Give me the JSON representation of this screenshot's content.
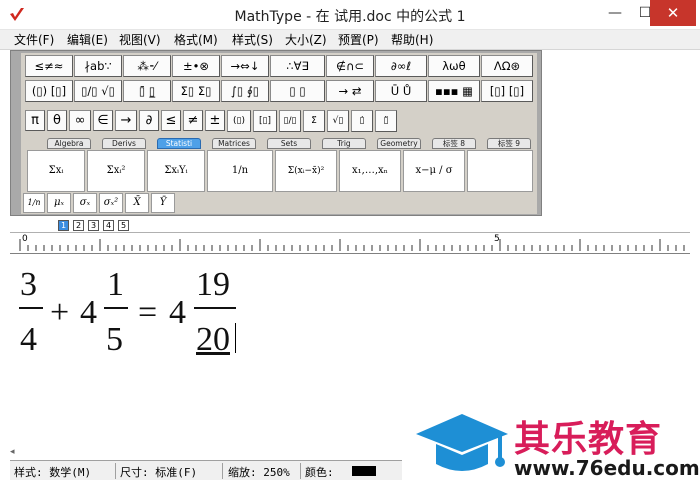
{
  "window": {
    "title": "MathType - 在 试用.doc 中的公式 1",
    "minimize": "—",
    "maximize": "☐",
    "close": "✕"
  },
  "menu": [
    "文件(F)",
    "编辑(E)",
    "视图(V)",
    "格式(M)",
    "样式(S)",
    "大小(Z)",
    "预置(P)",
    "帮助(H)"
  ],
  "palette_row1": [
    "≤≠≈",
    "∤ab∵",
    "⁂⁃⁄",
    "±•⊗",
    "→⇔↓",
    "∴∀∃",
    "∉∩⊂",
    "∂∞ℓ",
    "λωθ",
    "ΛΩ⊛"
  ],
  "palette_row2": [
    "(▯) [▯]",
    "▯/▯ √▯",
    "▯̄ ▯̲",
    "Σ▯ Σ▯",
    "∫▯ ∮▯",
    "▯ ▯",
    "→ ⇄",
    "Ū Ů",
    "▪▪▪ ▦",
    "[▯] [▯]"
  ],
  "symbol_bar": [
    "π",
    "θ",
    "∞",
    "∈",
    "→",
    "∂",
    "≤",
    "≠",
    "±",
    "(▯)",
    "[▯]",
    "▯/▯",
    "Σ̈",
    "√▯",
    "▯̇",
    "▯̈"
  ],
  "tabs": [
    "Algebra",
    "Derivs",
    "Statisti",
    "Matrices",
    "Sets",
    "Trig",
    "Geometry",
    "标签 8",
    "标签 9"
  ],
  "templates": [
    "Σxᵢ",
    "Σxᵢ²",
    "ΣxᵢYᵢ",
    "1/n",
    "Σ(xᵢ−x̄)²",
    "x₁,…,xₙ",
    "x−μ / σ"
  ],
  "templates_small": [
    "1/n",
    "μₓ",
    "σₓ",
    "σₓ²",
    "X̄",
    "Ȳ"
  ],
  "controls": [
    "1",
    "2",
    "3",
    "4",
    "5"
  ],
  "ruler": {
    "zero": "0",
    "mark": "5"
  },
  "equation": {
    "a_num": "3",
    "a_den": "4",
    "plus": "+",
    "b_whole": "4",
    "b_num": "1",
    "b_den": "5",
    "equals": "=",
    "c_whole": "4",
    "c_num": "19",
    "c_den": "20"
  },
  "status": {
    "style": "样式: 数学(M)",
    "size": "尺寸: 标准(F)",
    "zoom": "缩放: 250%",
    "color": "颜色:"
  },
  "watermark": {
    "title": "其乐教育",
    "url": "www.76edu.com"
  },
  "colors": {
    "accent": "#4ea0e8",
    "close": "#c7352b",
    "brand": "#d81d5a",
    "logo_blue": "#1e8fd5"
  }
}
